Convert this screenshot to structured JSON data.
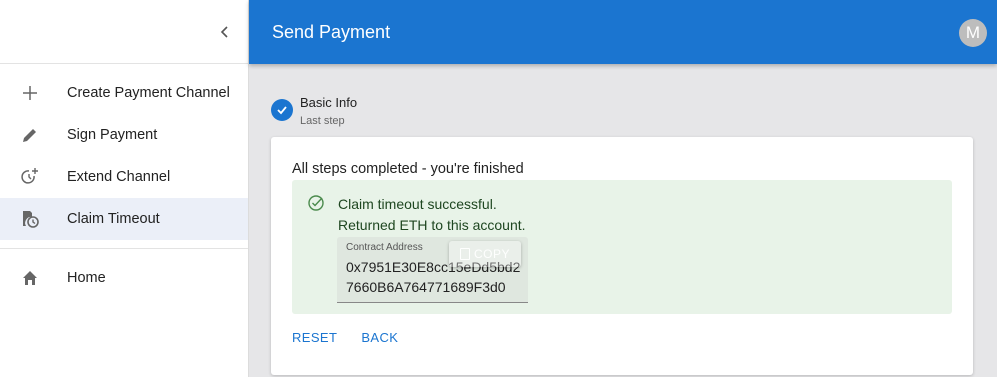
{
  "sidebar": {
    "collapse_icon": "chevron-left-icon",
    "items": [
      {
        "label": "Create Payment Channel",
        "icon": "plus-icon",
        "active": false
      },
      {
        "label": "Sign Payment",
        "icon": "pencil-icon",
        "active": false
      },
      {
        "label": "Extend Channel",
        "icon": "clock-plus-icon",
        "active": false
      },
      {
        "label": "Claim Timeout",
        "icon": "clock-document-icon",
        "active": true
      }
    ],
    "secondary_items": [
      {
        "label": "Home",
        "icon": "home-icon"
      }
    ]
  },
  "appbar": {
    "title": "Send Payment",
    "avatar_initial": "M",
    "color": "#1b75d0"
  },
  "stepper": {
    "step_title": "Basic Info",
    "step_subtitle": "Last step",
    "step_icon": "check-circle-icon"
  },
  "card": {
    "heading": "All steps completed - you're finished",
    "alert": {
      "icon": "check-circle-outline-icon",
      "line1": "Claim timeout successful.",
      "line2": "Returned ETH to this account.",
      "background": "#e8f3e8"
    },
    "address": {
      "label": "Contract Address",
      "value": "0x7951E30E8cc15eDd5bd27660B6A764771689F3d0",
      "copy_label": "COPY"
    },
    "actions": {
      "reset": "RESET",
      "back": "BACK"
    }
  }
}
